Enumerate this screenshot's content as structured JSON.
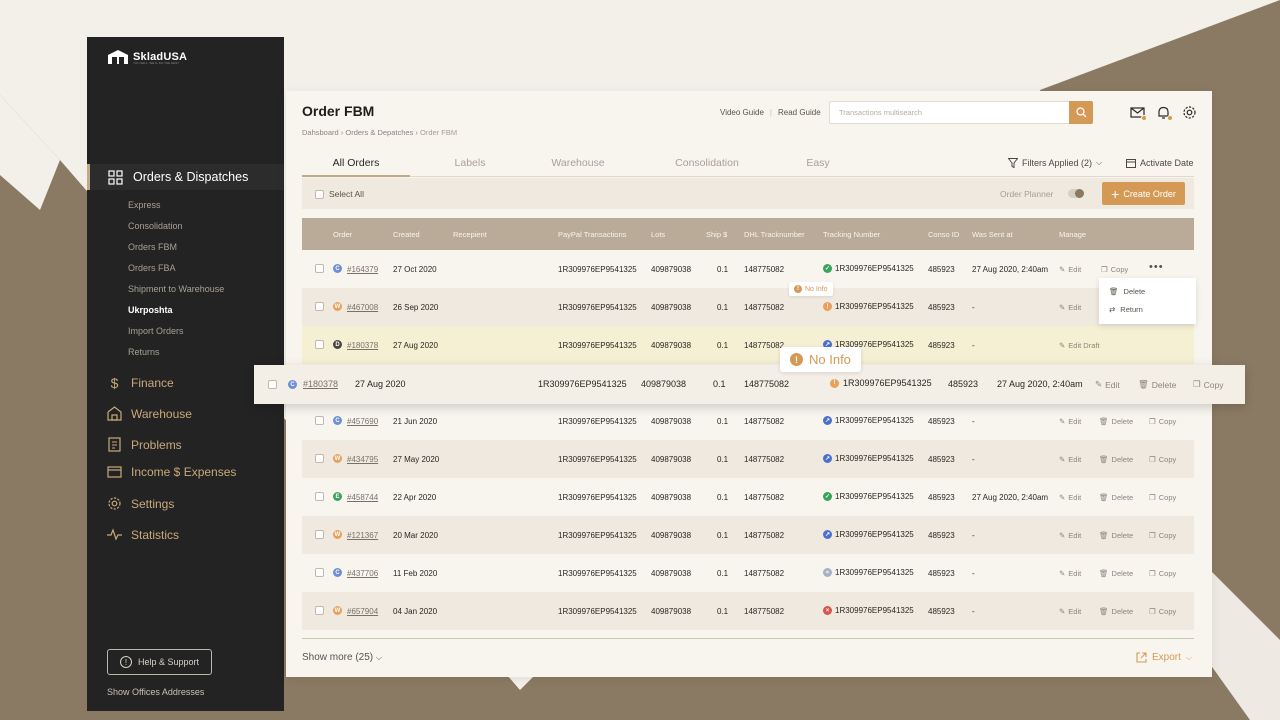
{
  "sidebar": {
    "brand": "SkladUSA",
    "tagline": "YOU SELL, WE'LL DO THE REST",
    "active_section": "Orders & Dispatches",
    "sub_items": [
      "Express",
      "Consolidation",
      "Orders FBM",
      "Orders FBA",
      "Shipment to Warehouse",
      "Ukrposhta",
      "Import Orders",
      "Returns"
    ],
    "active_sub_item": "Ukrposhta",
    "sections": [
      {
        "label": "Finance",
        "icon": "dollar-icon"
      },
      {
        "label": "Warehouse",
        "icon": "warehouse-icon"
      },
      {
        "label": "Problems",
        "icon": "document-icon"
      },
      {
        "label": "Income $ Expenses",
        "icon": "card-icon"
      },
      {
        "label": "Settings",
        "icon": "gear-icon"
      },
      {
        "label": "Statistics",
        "icon": "pulse-icon"
      }
    ],
    "help_label": "Help & Support",
    "offices_label": "Show Offices Addresses"
  },
  "header": {
    "title": "Order FBM",
    "breadcrumb": [
      "Dahsboard",
      "Orders & Depatches",
      "Order FBM"
    ],
    "video_guide": "Video Guide",
    "read_guide": "Read Guide",
    "search_placeholder": "Transactions multisearch"
  },
  "tabs": [
    "All Orders",
    "Labels",
    "Warehouse",
    "Consolidation",
    "Easy"
  ],
  "active_tab": "All Orders",
  "filters_label": "Filters Applied (2)",
  "activate_date_label": "Activate Date",
  "toolbar": {
    "select_all": "Select All",
    "order_planner": "Order Planner",
    "create_order": "Create Order"
  },
  "table": {
    "columns": [
      "Order",
      "Created",
      "Recepient",
      "PayPal Transactions",
      "Lots",
      "Ship $",
      "DHL Tracknumber",
      "Tracking Number",
      "Conso ID",
      "Was Sent at",
      "Manage"
    ],
    "rows": [
      {
        "status": "C",
        "status_color": "#6d8fd8",
        "order": "#164379",
        "created": "27 Oct 2020",
        "paypal": "1R309976EP9541325",
        "lots": "409879038",
        "ship": "0.1",
        "dhl": "148775082",
        "track_icon": "✓",
        "track_color": "#3aa35c",
        "tracking": "1R309976EP9541325",
        "conso": "485923",
        "sent": "27 Aug 2020, 2:40am",
        "edit": "Edit",
        "delete": "",
        "copy": "Copy"
      },
      {
        "status": "W",
        "status_color": "#e8a05c",
        "order": "#467008",
        "created": "26 Sep 2020",
        "paypal": "1R309976EP9541325",
        "lots": "409879038",
        "ship": "0.1",
        "dhl": "148775082",
        "track_icon": "!",
        "track_color": "#e8a05c",
        "tracking": "1R309976EP9541325",
        "conso": "485923",
        "sent": "-",
        "edit": "Edit",
        "delete": "",
        "copy": ""
      },
      {
        "status": "D",
        "status_color": "#4a4540",
        "order": "#180378",
        "created": "27 Aug 2020",
        "paypal": "1R309976EP9541325",
        "lots": "409879038",
        "ship": "0.1",
        "dhl": "148775082",
        "track_icon": "↗",
        "track_color": "#4a6fd0",
        "tracking": "1R309976EP9541325",
        "conso": "485923",
        "sent": "-",
        "edit": "Edit Draft",
        "delete": "",
        "copy": ""
      },
      {
        "status": "C",
        "status_color": "#6d8fd8",
        "order": "#457690",
        "created": "21 Jun 2020",
        "paypal": "1R309976EP9541325",
        "lots": "409879038",
        "ship": "0.1",
        "dhl": "148775082",
        "track_icon": "↗",
        "track_color": "#4a6fd0",
        "tracking": "1R309976EP9541325",
        "conso": "485923",
        "sent": "-",
        "edit": "Edit",
        "delete": "Delete",
        "copy": "Copy"
      },
      {
        "status": "W",
        "status_color": "#e8a05c",
        "order": "#434795",
        "created": "27 May 2020",
        "paypal": "1R309976EP9541325",
        "lots": "409879038",
        "ship": "0.1",
        "dhl": "148775082",
        "track_icon": "↗",
        "track_color": "#4a6fd0",
        "tracking": "1R309976EP9541325",
        "conso": "485923",
        "sent": "-",
        "edit": "Edit",
        "delete": "Delete",
        "copy": "Copy"
      },
      {
        "status": "E",
        "status_color": "#3aa35c",
        "order": "#458744",
        "created": "22 Apr 2020",
        "paypal": "1R309976EP9541325",
        "lots": "409879038",
        "ship": "0.1",
        "dhl": "148775082",
        "track_icon": "✓",
        "track_color": "#3aa35c",
        "tracking": "1R309976EP9541325",
        "conso": "485923",
        "sent": "27 Aug 2020, 2:40am",
        "edit": "Edit",
        "delete": "Delete",
        "copy": "Copy"
      },
      {
        "status": "W",
        "status_color": "#e8a05c",
        "order": "#121367",
        "created": "20 Mar 2020",
        "paypal": "1R309976EP9541325",
        "lots": "409879038",
        "ship": "0.1",
        "dhl": "148775082",
        "track_icon": "↗",
        "track_color": "#4a6fd0",
        "tracking": "1R309976EP9541325",
        "conso": "485923",
        "sent": "-",
        "edit": "Edit",
        "delete": "Delete",
        "copy": "Copy"
      },
      {
        "status": "C",
        "status_color": "#6d8fd8",
        "order": "#437706",
        "created": "11 Feb 2020",
        "paypal": "1R309976EP9541325",
        "lots": "409879038",
        "ship": "0.1",
        "dhl": "148775082",
        "track_icon": "≈",
        "track_color": "#a7b0c5",
        "tracking": "1R309976EP9541325",
        "conso": "485923",
        "sent": "-",
        "edit": "Edit",
        "delete": "Delete",
        "copy": "Copy"
      },
      {
        "status": "W",
        "status_color": "#e8a05c",
        "order": "#657904",
        "created": "04 Jan 2020",
        "paypal": "1R309976EP9541325",
        "lots": "409879038",
        "ship": "0.1",
        "dhl": "148775082",
        "track_icon": "×",
        "track_color": "#d9534f",
        "tracking": "1R309976EP9541325",
        "conso": "485923",
        "sent": "-",
        "edit": "Edit",
        "delete": "Delete",
        "copy": "Copy"
      }
    ]
  },
  "row_menu": {
    "delete": "Delete",
    "return": "Return"
  },
  "tooltip_small": "No Info",
  "tooltip_big": "No Info",
  "expanded_row": {
    "status": "C",
    "status_color": "#6d8fd8",
    "order": "#180378",
    "created": "27 Aug 2020",
    "paypal": "1R309976EP9541325",
    "lots": "409879038",
    "ship": "0.1",
    "dhl": "148775082",
    "tracking": "1R309976EP9541325",
    "conso": "485923",
    "sent": "27 Aug 2020, 2:40am",
    "edit": "Edit",
    "delete": "Delete",
    "copy": "Copy"
  },
  "footer": {
    "show_more": "Show more (25)",
    "export": "Export"
  },
  "colors": {
    "accent": "#d49a55",
    "sidebar": "#232323",
    "header_row": "#b9ab98"
  }
}
